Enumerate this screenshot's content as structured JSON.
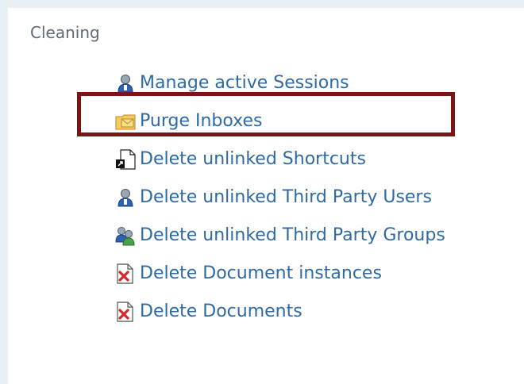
{
  "section": {
    "title": "Cleaning"
  },
  "menu": {
    "items": [
      {
        "label": "Manage active Sessions",
        "icon": "user-icon"
      },
      {
        "label": "Purge Inboxes",
        "icon": "inbox-folder-icon"
      },
      {
        "label": "Delete unlinked Shortcuts",
        "icon": "shortcut-icon"
      },
      {
        "label": "Delete unlinked Third Party Users",
        "icon": "user-icon"
      },
      {
        "label": "Delete unlinked Third Party Groups",
        "icon": "group-icon"
      },
      {
        "label": "Delete Document instances",
        "icon": "delete-document-icon"
      },
      {
        "label": "Delete Documents",
        "icon": "delete-document-icon"
      }
    ]
  },
  "highlight": {
    "target": "Purge Inboxes",
    "color": "#7a1416"
  },
  "colors": {
    "link": "#2f6aa3",
    "title": "#5e6a74",
    "background": "#e9f0f5"
  }
}
